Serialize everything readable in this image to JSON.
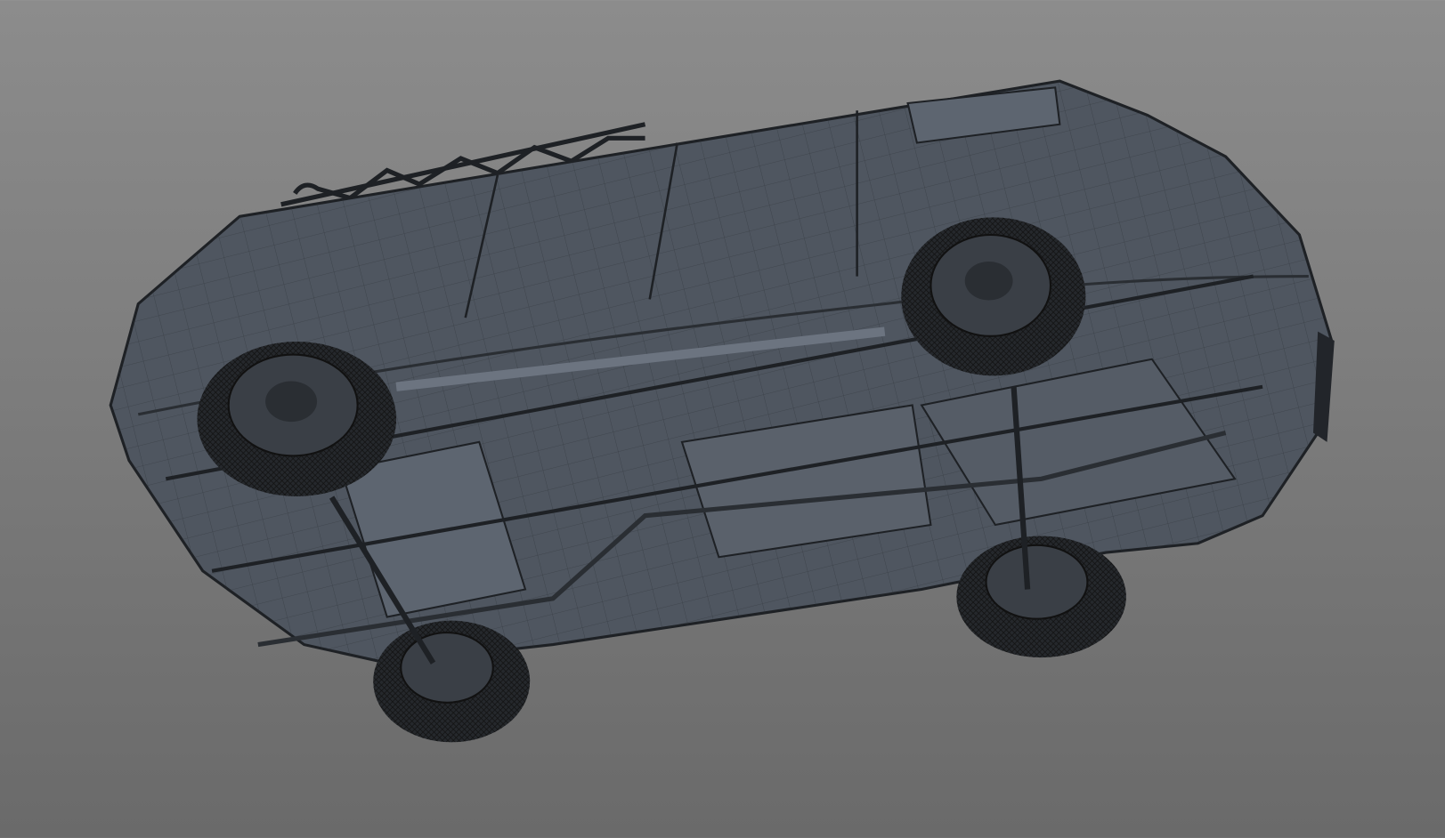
{
  "scene": {
    "subject": "van-3d-wireframe-underside",
    "colors": {
      "background_top": "#8c8c8c",
      "background_bottom": "#6a6a6a",
      "body": "#4f5660",
      "body_light": "#5d6570",
      "wire": "#2a2e33",
      "tire": "#25282c",
      "rim": "#3a3f46"
    }
  }
}
